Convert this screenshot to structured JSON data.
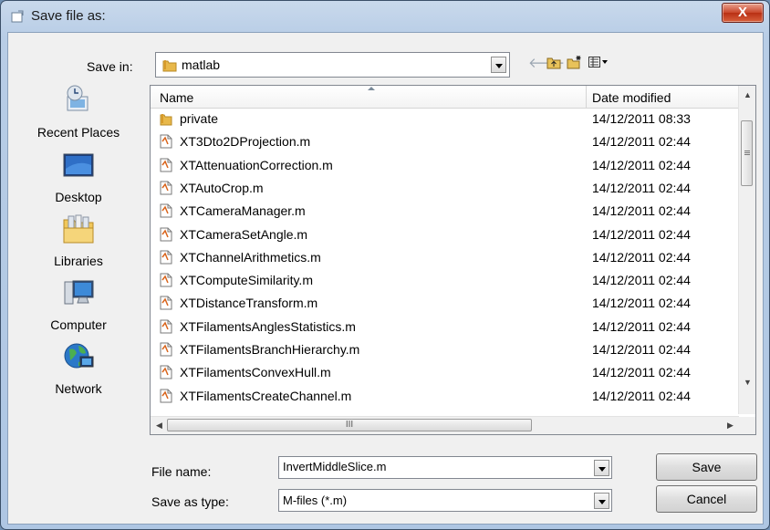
{
  "window": {
    "title": "Save file as:",
    "close_label": "X"
  },
  "toolbar": {
    "save_in_label": "Save in:",
    "save_in_value": "matlab",
    "back_icon": "back-arrow-icon",
    "up_icon": "up-folder-icon",
    "new_folder_icon": "new-folder-icon",
    "views_icon": "views-menu-icon"
  },
  "places": [
    {
      "label": "Recent Places",
      "icon": "recent-places-icon"
    },
    {
      "label": "Desktop",
      "icon": "desktop-icon"
    },
    {
      "label": "Libraries",
      "icon": "libraries-icon"
    },
    {
      "label": "Computer",
      "icon": "computer-icon"
    },
    {
      "label": "Network",
      "icon": "network-icon"
    }
  ],
  "list": {
    "columns": {
      "name": "Name",
      "date": "Date modified"
    },
    "rows": [
      {
        "name": "private",
        "date": "14/12/2011 08:33",
        "type": "folder"
      },
      {
        "name": "XT3Dto2DProjection.m",
        "date": "14/12/2011 02:44",
        "type": "file"
      },
      {
        "name": "XTAttenuationCorrection.m",
        "date": "14/12/2011 02:44",
        "type": "file"
      },
      {
        "name": "XTAutoCrop.m",
        "date": "14/12/2011 02:44",
        "type": "file"
      },
      {
        "name": "XTCameraManager.m",
        "date": "14/12/2011 02:44",
        "type": "file"
      },
      {
        "name": "XTCameraSetAngle.m",
        "date": "14/12/2011 02:44",
        "type": "file"
      },
      {
        "name": "XTChannelArithmetics.m",
        "date": "14/12/2011 02:44",
        "type": "file"
      },
      {
        "name": "XTComputeSimilarity.m",
        "date": "14/12/2011 02:44",
        "type": "file"
      },
      {
        "name": "XTDistanceTransform.m",
        "date": "14/12/2011 02:44",
        "type": "file"
      },
      {
        "name": "XTFilamentsAnglesStatistics.m",
        "date": "14/12/2011 02:44",
        "type": "file"
      },
      {
        "name": "XTFilamentsBranchHierarchy.m",
        "date": "14/12/2011 02:44",
        "type": "file"
      },
      {
        "name": "XTFilamentsConvexHull.m",
        "date": "14/12/2011 02:44",
        "type": "file"
      },
      {
        "name": "XTFilamentsCreateChannel.m",
        "date": "14/12/2011 02:44",
        "type": "file"
      }
    ],
    "hscroll_grip": "III"
  },
  "file_name": {
    "label": "File name:",
    "value": "InvertMiddleSlice.m"
  },
  "save_as_type": {
    "label": "Save as type:",
    "value": "M-files (*.m)"
  },
  "buttons": {
    "save": "Save",
    "cancel": "Cancel"
  },
  "colors": {
    "title_bar": "#b8cde6",
    "close_red": "#c9452a",
    "folder_yellow": "#e8b84a"
  }
}
